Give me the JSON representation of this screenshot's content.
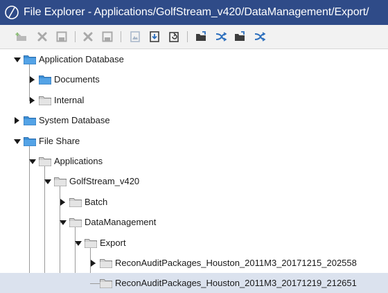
{
  "window": {
    "title": "File Explorer - Applications/GolfStream_v420/DataManagement/Export/"
  },
  "toolbar": {
    "buttons": [
      {
        "name": "add-folder-icon"
      },
      {
        "name": "delete-icon"
      },
      {
        "name": "save-icon"
      },
      {
        "name": "delete-file-icon"
      },
      {
        "name": "save-file-icon"
      },
      {
        "name": "image-icon"
      },
      {
        "name": "download-icon"
      },
      {
        "name": "refresh-icon"
      },
      {
        "name": "open-folder-icon"
      },
      {
        "name": "shuffle-icon"
      },
      {
        "name": "open-folder-2-icon"
      },
      {
        "name": "shuffle-2-icon"
      }
    ]
  },
  "tree": {
    "nodes": [
      {
        "label": "Application Database",
        "expanded": true,
        "state": "expanded",
        "folder_color": "blue"
      },
      {
        "label": "Documents",
        "state": "collapsed",
        "folder_color": "blue"
      },
      {
        "label": "Internal",
        "state": "collapsed",
        "folder_color": "gray"
      },
      {
        "label": "System Database",
        "state": "collapsed",
        "folder_color": "blue"
      },
      {
        "label": "File Share",
        "state": "expanded",
        "folder_color": "blue"
      },
      {
        "label": "Applications",
        "state": "expanded",
        "folder_color": "gray"
      },
      {
        "label": "GolfStream_v420",
        "state": "expanded",
        "folder_color": "gray"
      },
      {
        "label": "Batch",
        "state": "collapsed",
        "folder_color": "gray"
      },
      {
        "label": "DataManagement",
        "state": "expanded",
        "folder_color": "gray"
      },
      {
        "label": "Export",
        "state": "expanded",
        "folder_color": "gray"
      },
      {
        "label": "ReconAuditPackages_Houston_2011M3_20171215_202558",
        "state": "collapsed",
        "folder_color": "gray"
      },
      {
        "label": "ReconAuditPackages_Houston_2011M3_20171219_212651",
        "state": "leaf",
        "folder_color": "gray",
        "selected": true
      }
    ]
  },
  "colors": {
    "titlebar": "#2f4b88",
    "selection": "#dbe2ee",
    "blue_folder": "#3c8fd6",
    "gray_folder": "#cfcfcf"
  }
}
